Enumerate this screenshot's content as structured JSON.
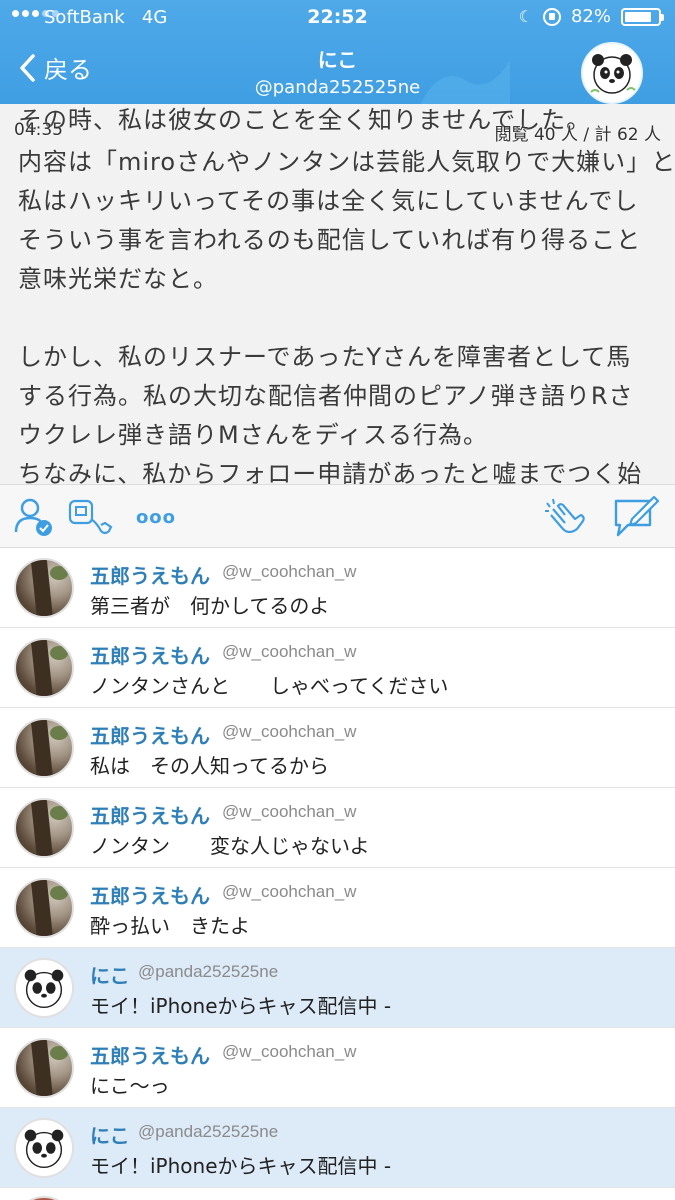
{
  "status_bar": {
    "carrier": "SoftBank",
    "network": "4G",
    "time": "22:52",
    "battery_percent": "82%",
    "battery_level": 0.82
  },
  "nav": {
    "back_label": "戻る",
    "title": "にこ",
    "subtitle": "@panda252525ne"
  },
  "live": {
    "timer": "04:35",
    "viewers": "閲覧 40 人 / 計 62 人",
    "lines": [
      "その時、私は彼女のことを全く知りませんでした。",
      "内容は「miroさんやノンタンは芸能人気取りで大嫌い」と",
      "私はハッキリいってその事は全く気にしていませんでし",
      "そういう事を言われるのも配信していれば有り得ること",
      "意味光栄だなと。",
      "",
      "しかし、私のリスナーであったYさんを障害者として馬",
      "する行為。私の大切な配信者仲間のピアノ弾き語りRさ",
      "ウクレレ弾き語りMさんをディスる行為。",
      "ちなみに、私からフォロー申請があったと嘘までつく始"
    ]
  },
  "toolbar": {
    "icons": [
      "user-check-icon",
      "video-call-icon",
      "more-icon",
      "clap-icon",
      "compose-icon"
    ],
    "more_label": "ooo"
  },
  "comments": [
    {
      "name": "五郎うえもん",
      "handle": "@w_coohchan_w",
      "text": "第三者が　何かしてるのよ",
      "avatar": "tree",
      "self": false
    },
    {
      "name": "五郎うえもん",
      "handle": "@w_coohchan_w",
      "text": "ノンタンさんと　　しゃべってください",
      "avatar": "tree",
      "self": false
    },
    {
      "name": "五郎うえもん",
      "handle": "@w_coohchan_w",
      "text": "私は　その人知ってるから",
      "avatar": "tree",
      "self": false
    },
    {
      "name": "五郎うえもん",
      "handle": "@w_coohchan_w",
      "text": "ノンタン　　変な人じゃないよ",
      "avatar": "tree",
      "self": false
    },
    {
      "name": "五郎うえもん",
      "handle": "@w_coohchan_w",
      "text": "酔っ払い　きたよ",
      "avatar": "tree",
      "self": false
    },
    {
      "name": "にこ",
      "handle": "@panda252525ne",
      "text": "モイ！iPhoneからキャス配信中 -",
      "avatar": "panda",
      "self": true
    },
    {
      "name": "五郎うえもん",
      "handle": "@w_coohchan_w",
      "text": "にこ〜っ",
      "avatar": "tree",
      "self": false
    },
    {
      "name": "にこ",
      "handle": "@panda252525ne",
      "text": "モイ！iPhoneからキャス配信中 -",
      "avatar": "panda",
      "self": true
    }
  ],
  "colors": {
    "header": "#3f9ee2",
    "name": "#2e7fb8",
    "self_row": "#ddeaf8",
    "icon": "#3f9ee2"
  }
}
